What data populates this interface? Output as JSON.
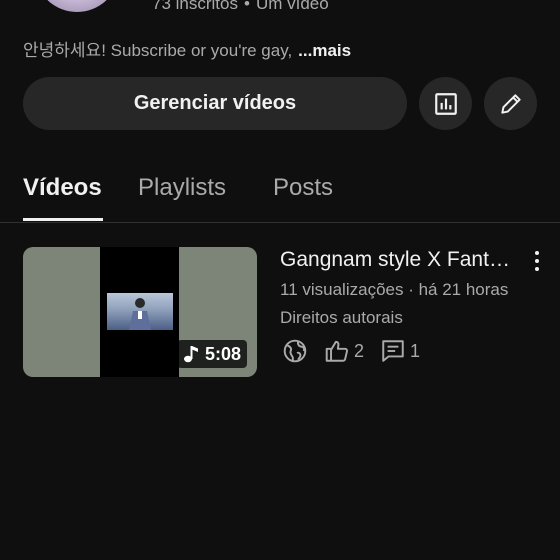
{
  "channel": {
    "subscribers": "73 inscritos",
    "separator": "•",
    "video_count": "Um vídeo",
    "description": "안녕하세요! Subscribe or you're gay,",
    "more_label": "...mais"
  },
  "actions": {
    "manage_videos_label": "Gerenciar vídeos",
    "analytics_icon": "bar-chart-icon",
    "edit_icon": "pencil-icon"
  },
  "tabs": [
    {
      "label": "Vídeos",
      "active": true
    },
    {
      "label": "Playlists",
      "active": false
    },
    {
      "label": "Posts",
      "active": false
    }
  ],
  "video": {
    "title": "Gangnam style X Fantasy",
    "duration": "5:08",
    "meta": "11 visualizações · há 21 horas",
    "copyright": "Direitos autorais",
    "likes": "2",
    "comments": "1",
    "visibility_icon": "globe-icon"
  },
  "colors": {
    "background": "#0f0f0f",
    "surface": "#272727",
    "primary_text": "#f1f1f1",
    "secondary_text": "#aaaaaa"
  }
}
